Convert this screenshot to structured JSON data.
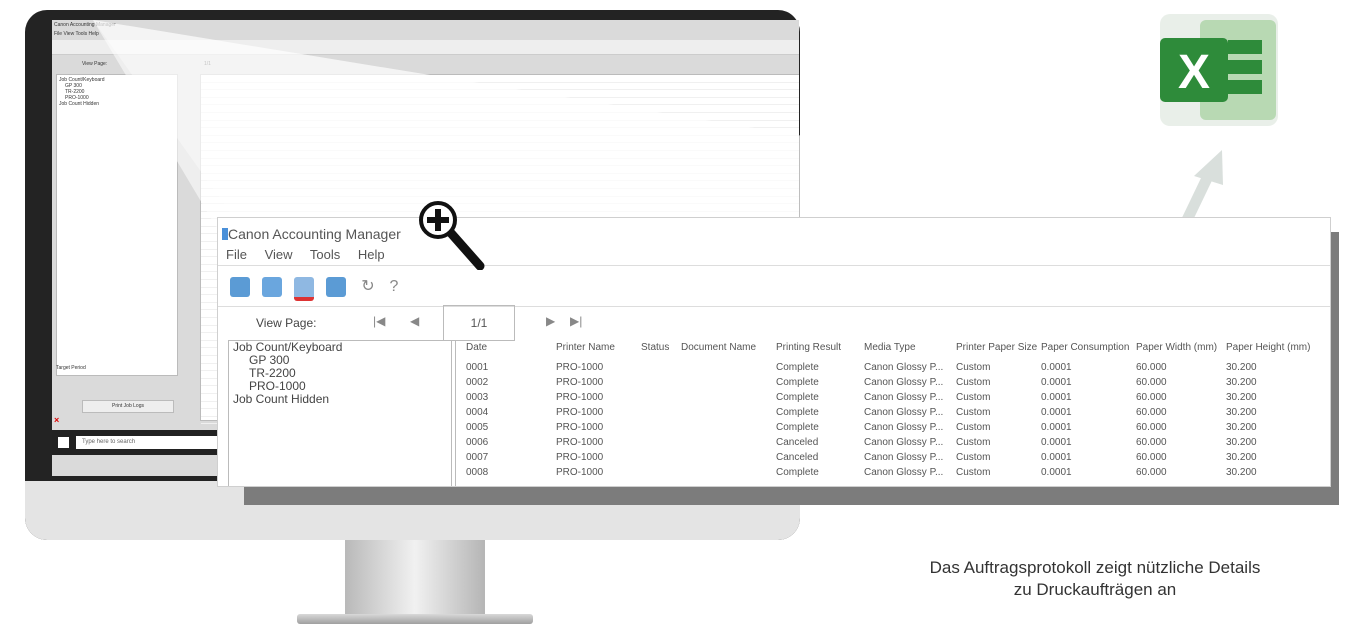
{
  "small_screen": {
    "title": "Canon Accounting Manager",
    "menu": "File  View  Tools  Help",
    "view_page": "View Page:",
    "page": "1/1",
    "tree": [
      "Job Count/Keyboard",
      "GP 300",
      "TR-2200",
      "PRO-1000",
      "Job Count Hidden"
    ],
    "target_period": "Target Period",
    "print_button": "Print Job Logs",
    "search_placeholder": "Type here to search",
    "close": "×"
  },
  "zoom": {
    "title": "Canon Accounting Manager",
    "menu": [
      "File",
      "View",
      "Tools",
      "Help"
    ],
    "view_page": "View Page:",
    "page": "1/1",
    "tree": [
      "Job Count/Keyboard",
      "GP 300",
      "TR-2200",
      "PRO-1000",
      "Job Count Hidden"
    ],
    "columns": [
      "Date",
      "Printer Name",
      "Status",
      "Document Name",
      "Printing Result",
      "Media Type",
      "Printer Paper Size",
      "Paper Consumption",
      "Paper Width (mm)",
      "Paper Height (mm)"
    ],
    "rows": [
      [
        "0001",
        "PRO-1000",
        "Complete",
        "Canon Glossy P...",
        "Custom",
        "0.0001",
        "60.000",
        "30.200"
      ],
      [
        "0002",
        "PRO-1000",
        "Complete",
        "Canon Glossy P...",
        "Custom",
        "0.0001",
        "60.000",
        "30.200"
      ],
      [
        "0003",
        "PRO-1000",
        "Complete",
        "Canon Glossy P...",
        "Custom",
        "0.0001",
        "60.000",
        "30.200"
      ],
      [
        "0004",
        "PRO-1000",
        "Complete",
        "Canon Glossy P...",
        "Custom",
        "0.0001",
        "60.000",
        "30.200"
      ],
      [
        "0005",
        "PRO-1000",
        "Complete",
        "Canon Glossy P...",
        "Custom",
        "0.0001",
        "60.000",
        "30.200"
      ],
      [
        "0006",
        "PRO-1000",
        "Canceled",
        "Canon Glossy P...",
        "Custom",
        "0.0001",
        "60.000",
        "30.200"
      ],
      [
        "0007",
        "PRO-1000",
        "Canceled",
        "Canon Glossy P...",
        "Custom",
        "0.0001",
        "60.000",
        "30.200"
      ],
      [
        "0008",
        "PRO-1000",
        "Complete",
        "Canon Glossy P...",
        "Custom",
        "0.0001",
        "60.000",
        "30.200"
      ]
    ]
  },
  "caption": {
    "line1": "Das Auftragsprotokoll zeigt nützliche Details",
    "line2": "zu Druckaufträgen an"
  },
  "colors": {
    "excel_green": "#2e8b3a",
    "arrow": "#d9dfdc"
  },
  "icons": [
    "magnifier-plus-icon",
    "excel-icon",
    "arrow-up-right-icon"
  ]
}
